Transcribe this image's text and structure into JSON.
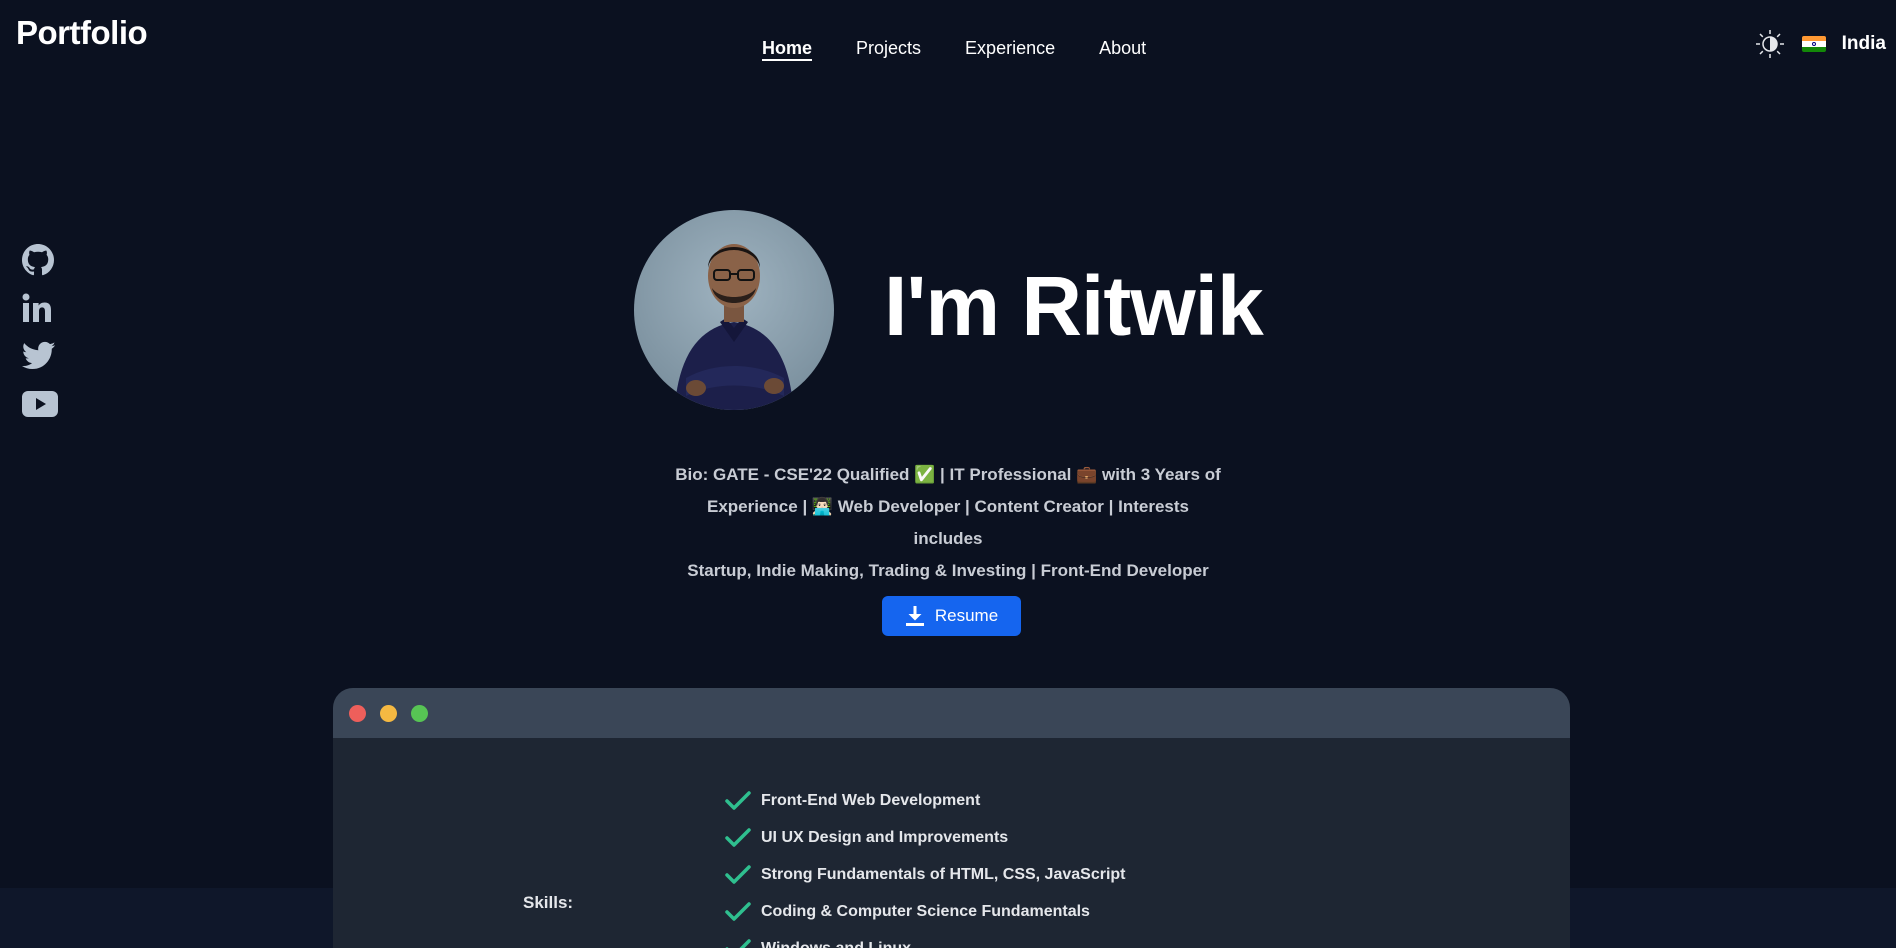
{
  "header": {
    "logo": "Portfolio",
    "nav": [
      {
        "label": "Home",
        "active": true
      },
      {
        "label": "Projects",
        "active": false
      },
      {
        "label": "Experience",
        "active": false
      },
      {
        "label": "About",
        "active": false
      }
    ],
    "theme_icon": "theme-toggle-icon",
    "flag_icon": "india-flag-icon",
    "country": "India"
  },
  "social": [
    {
      "name": "github-icon"
    },
    {
      "name": "linkedin-icon"
    },
    {
      "name": "twitter-icon"
    },
    {
      "name": "youtube-icon"
    }
  ],
  "hero": {
    "avatar_alt": "profile-photo",
    "title": "I'm Ritwik",
    "bio_line1": "Bio: GATE - CSE'22 Qualified ✅ | IT Professional 💼 with 3 Years of",
    "bio_line2": "Experience | 👨🏻‍💻 Web Developer | Content Creator | Interests includes",
    "bio_line3_prefix": "Startup, Indie Making, Trading & Investing | ",
    "bio_line3_strong": "Front-End Developer",
    "resume_label": "Resume"
  },
  "window": {
    "dot_colors": [
      "#ee5f5b",
      "#f5b942",
      "#57c454"
    ],
    "skills_label": "Skills:",
    "skills": [
      "Front-End Web Development",
      "UI UX Design and Improvements",
      "Strong Fundamentals of HTML, CSS, JavaScript",
      "Coding & Computer Science Fundamentals",
      "Windows and Linux"
    ]
  },
  "colors": {
    "background": "#0b1120",
    "accent": "#1565ef",
    "check": "#2fbf8f"
  }
}
